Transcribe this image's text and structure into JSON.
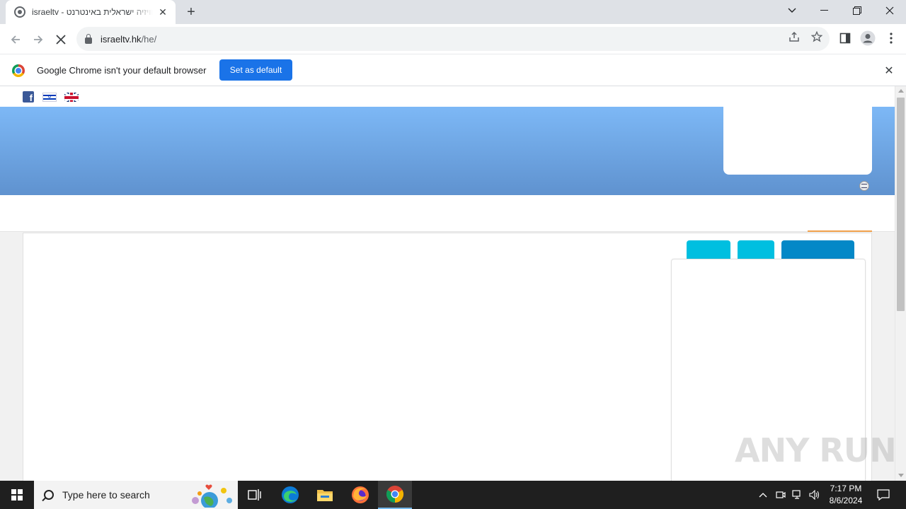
{
  "browser": {
    "tab_title": "israeltv - טלוויזיה ישראלית באינטרנט",
    "url_host": "israeltv.hk",
    "url_path": "/he/",
    "new_tab_glyph": "+",
    "close_glyph": "✕"
  },
  "infobar": {
    "message": "Google Chrome isn't your default browser",
    "button_label": "Set as default"
  },
  "page": {
    "banner_color_top": "#7db8f6",
    "banner_color_bottom": "#5f92cf",
    "tab_colors": [
      "#00bfe0",
      "#00bfe0",
      "#0388c7"
    ],
    "accent_line": "#f0a04a"
  },
  "watermark": "ANY RUN",
  "taskbar": {
    "search_placeholder": "Type here to search",
    "time": "7:17 PM",
    "date": "8/6/2024"
  }
}
